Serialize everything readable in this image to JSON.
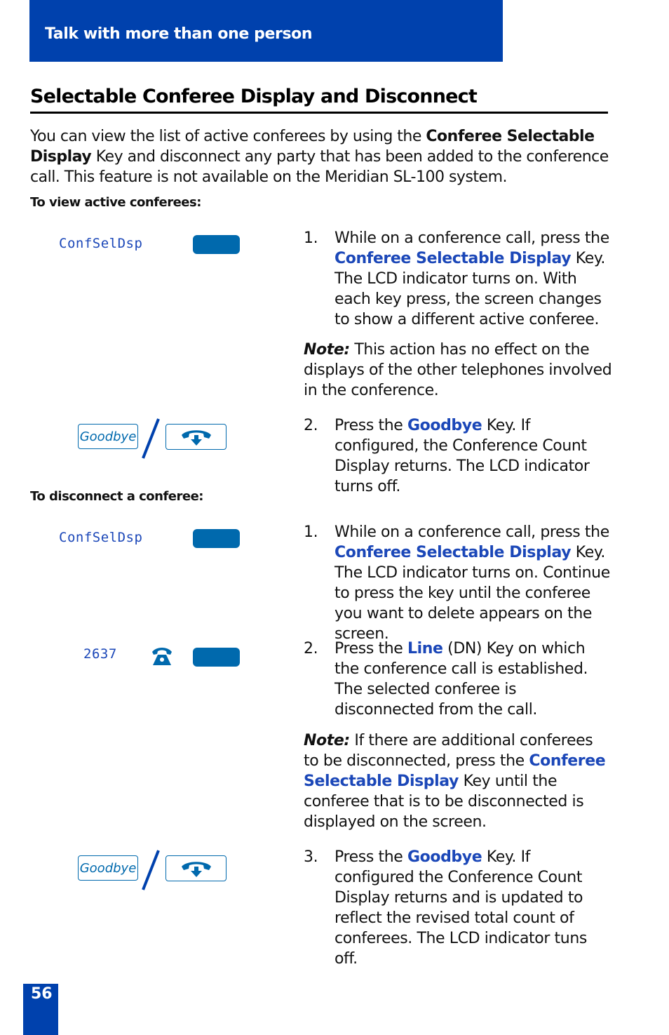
{
  "header": {
    "title": "Talk with more than one person"
  },
  "section": {
    "title": "Selectable Conferee Display and Disconnect",
    "intro_pre": "You can view the list of active conferees by using the ",
    "intro_bold": "Conferee Selectable Display",
    "intro_post": " Key and disconnect any party that has been added to the conference call. This feature is not available on the Meridian SL-100 system."
  },
  "view": {
    "subhead": "To view active conferees:",
    "lcd_label": "ConfSelDsp",
    "goodbye_label": "Goodbye",
    "steps": [
      {
        "num": "1.",
        "pre": "While on a conference call, press the ",
        "kw": "Conferee Selectable Display",
        "post": " Key. The LCD indicator turns on. With each key press, the screen changes to show a different active conferee."
      },
      {
        "num": "2.",
        "pre": "Press the ",
        "kw": "Goodbye",
        "post": " Key. If configured, the Conference Count Display returns. The LCD indicator turns off."
      }
    ],
    "note": {
      "label": "Note:",
      "text": " This action has no effect on the displays of the other telephones involved in the conference."
    }
  },
  "disconnect": {
    "subhead": "To disconnect a conferee:",
    "lcd_label": "ConfSelDsp",
    "line_dn": "2637",
    "goodbye_label": "Goodbye",
    "steps": [
      {
        "num": "1.",
        "pre": "While on a conference call, press the ",
        "kw": "Conferee Selectable Display",
        "post": " Key. The LCD indicator turns on. Continue to press the key until the conferee you want to delete appears on the screen."
      },
      {
        "num": "2.",
        "pre": "Press the ",
        "kw": "Line",
        "post": " (DN) Key on which the conference call is established. The selected conferee is disconnected from the call."
      },
      {
        "num": "3.",
        "pre": "Press the ",
        "kw": "Goodbye",
        "post": " Key. If configured the Conference Count Display returns and is updated to reflect the revised total count of conferees. The LCD indicator tuns off."
      }
    ],
    "note": {
      "label": "Note:",
      "pre": " If there are additional conferees to be disconnected, press the ",
      "kw": "Conferee Selectable Display",
      "post": " Key until the conferee that is to be disconnected is displayed on the screen."
    }
  },
  "footer": {
    "page_number": "56"
  },
  "colors": {
    "brand_blue": "#0041ad",
    "key_blue": "#0069ad",
    "keyword_blue": "#1b47b8"
  }
}
